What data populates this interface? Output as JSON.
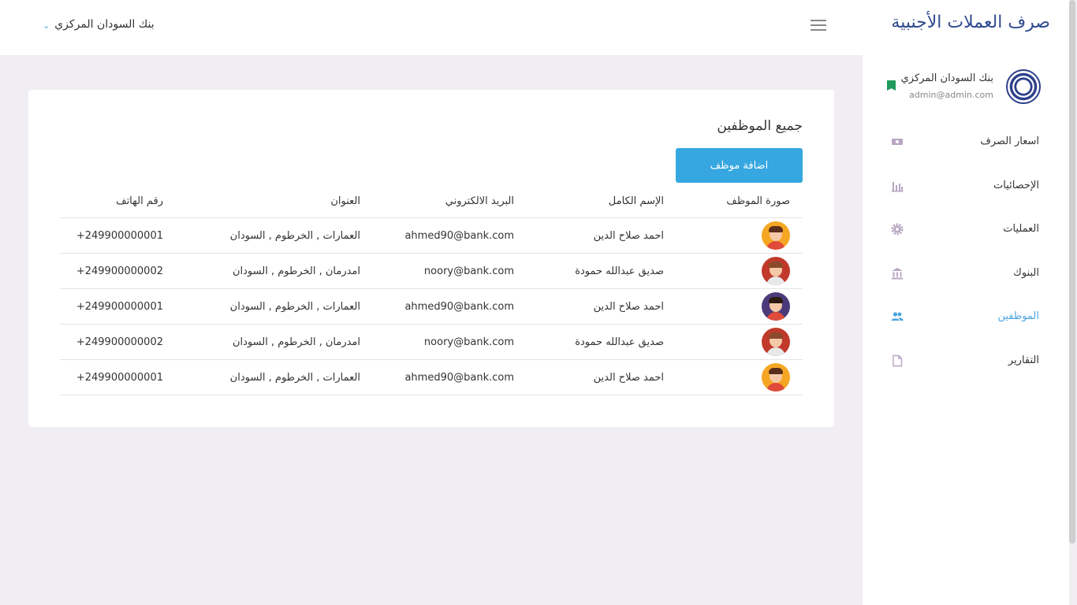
{
  "header": {
    "account_name": "بنك السودان المركزي",
    "chevron_icon": "chevron-down-icon",
    "menu_icon": "hamburger-menu-icon"
  },
  "sidebar": {
    "app_title": "صرف العملات الأجنبية",
    "profile": {
      "name": "بنك السودان المركزي",
      "email": "admin@admin.com",
      "badge_color": "#1e9a5a"
    },
    "items": [
      {
        "label": "اسعار الصرف",
        "icon": "money-icon",
        "active": false
      },
      {
        "label": "الإحصائيات",
        "icon": "bar-chart-icon",
        "active": false
      },
      {
        "label": "العمليات",
        "icon": "gear-icon",
        "active": false
      },
      {
        "label": "البنوك",
        "icon": "bank-icon",
        "active": false
      },
      {
        "label": "الموظفين",
        "icon": "people-icon",
        "active": true
      },
      {
        "label": "التقارير",
        "icon": "document-icon",
        "active": false
      }
    ],
    "active_color": "#4aa3df"
  },
  "main": {
    "title": "جميع الموظفين",
    "add_button_label": "اضافة موظف",
    "accent_color": "#36a7e0",
    "table": {
      "headers": {
        "photo": "صورة الموظف",
        "name": "الإسم الكامل",
        "email": "البريد الالكتروني",
        "address": "العنوان",
        "phone": "رقم الهاتف"
      },
      "rows": [
        {
          "name": "احمد صلاح الدين",
          "email": "ahmed90@bank.com",
          "address": "العمارات , الخرطوم , السودان",
          "phone": "249900000001+",
          "avatar_bg": "#f5a623"
        },
        {
          "name": "صديق عبدالله حمودة",
          "email": "noory@bank.com",
          "address": "امدرمان , الخرطوم , السودان",
          "phone": "249900000002+",
          "avatar_bg": "#c0392b"
        },
        {
          "name": "احمد صلاح الدين",
          "email": "ahmed90@bank.com",
          "address": "العمارات , الخرطوم , السودان",
          "phone": "249900000001+",
          "avatar_bg": "#4b3a7a"
        },
        {
          "name": "صديق عبدالله حمودة",
          "email": "noory@bank.com",
          "address": "امدرمان , الخرطوم , السودان",
          "phone": "249900000002+",
          "avatar_bg": "#c0392b"
        },
        {
          "name": "احمد صلاح الدين",
          "email": "ahmed90@bank.com",
          "address": "العمارات , الخرطوم , السودان",
          "phone": "249900000001+",
          "avatar_bg": "#f5a623"
        }
      ]
    }
  }
}
